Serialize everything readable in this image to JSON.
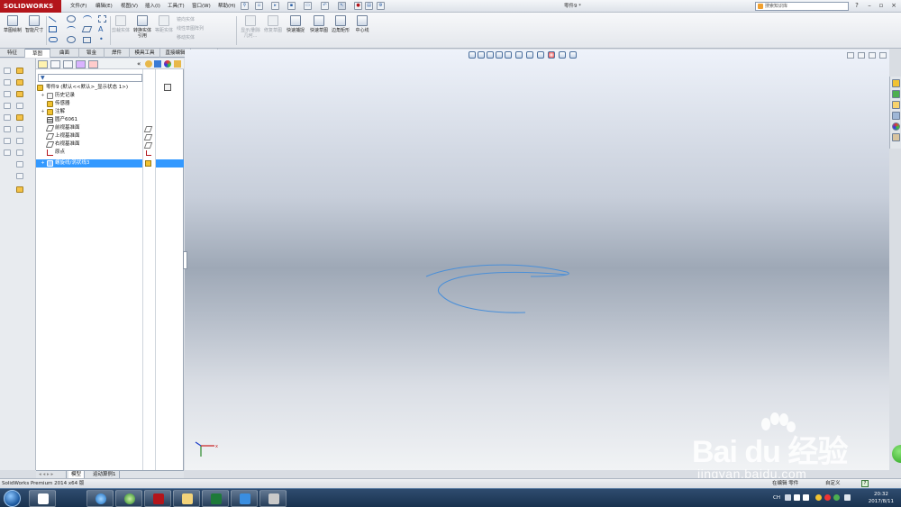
{
  "app": {
    "brand": "SOLIDWORKS",
    "document_title": "零件9 *",
    "search_placeholder": "搜索知识库"
  },
  "menu": [
    "文件(F)",
    "编辑(E)",
    "视图(V)",
    "插入(I)",
    "工具(T)",
    "窗口(W)",
    "帮助(H)"
  ],
  "command_manager": {
    "sketch_draw": "草图绘制",
    "smart_dim": "智能尺寸",
    "mirror_entities": "镜向实体",
    "linear_pattern": "线性草图阵列",
    "move_entities": "移动实体",
    "trim": "剪裁实体",
    "convert": "转换实体引用",
    "offset": "等距实体",
    "display_delete": "显示/删除几何...",
    "repair": "修复草图",
    "quick_snaps": "快速捕捉",
    "rapid_sketch": "快速草图",
    "corner_rect": "边角矩形",
    "centerline": "中心线"
  },
  "tabs": [
    "特征",
    "草图",
    "曲面",
    "钣金",
    "焊件",
    "模具工具",
    "直接编辑",
    "评估"
  ],
  "active_tab": "草图",
  "feature_tree": {
    "root": "零件9 (默认<<默认>_显示状态 1>)",
    "items": [
      {
        "label": "历史记录",
        "icon": "history-icon"
      },
      {
        "label": "传感器",
        "icon": "sensor-icon"
      },
      {
        "label": "注解",
        "icon": "annotation-icon"
      },
      {
        "label": "圆产6061",
        "icon": "material-icon"
      },
      {
        "label": "前视基准面",
        "icon": "plane-icon"
      },
      {
        "label": "上视基准面",
        "icon": "plane-icon"
      },
      {
        "label": "右视基准面",
        "icon": "plane-icon"
      },
      {
        "label": "原点",
        "icon": "origin-icon"
      },
      {
        "label": "螺旋线/涡状线3",
        "icon": "helix-icon",
        "selected": true
      }
    ]
  },
  "fm_bottom_tabs": [
    "模型",
    "运动算例1"
  ],
  "status": {
    "left": "SolidWorks Premium 2014 x64 版",
    "editing": "在编辑 零件",
    "custom": "自定义"
  },
  "taskbar": {
    "lang": "CH",
    "time": "20:32",
    "date": "2017/8/11"
  },
  "watermark": {
    "logo": "Bai du 经验",
    "url": "jingyan.baidu.com"
  },
  "colors": {
    "brand_red": "#b3151b",
    "selection_blue": "#3399ff",
    "helix_blue": "#4a8fd8"
  }
}
